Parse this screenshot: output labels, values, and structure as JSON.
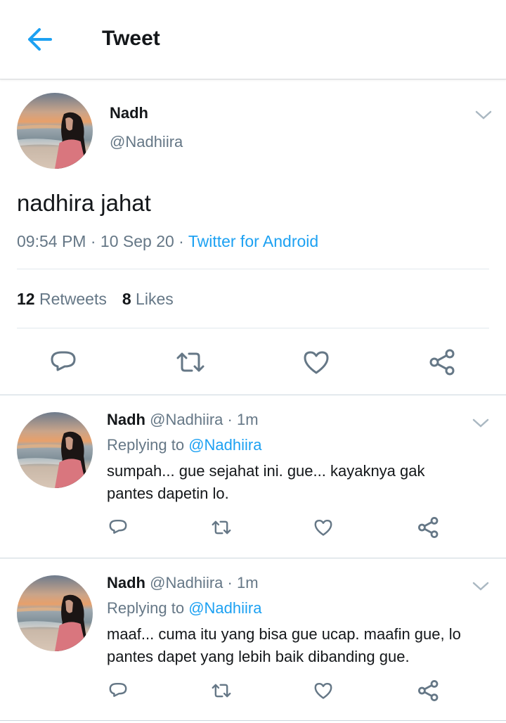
{
  "header": {
    "title": "Tweet",
    "back_icon": "arrow-left-icon"
  },
  "colors": {
    "accent": "#1da1f2",
    "secondary_text": "#657786",
    "primary_text": "#14171a"
  },
  "main_tweet": {
    "name": "Nadh",
    "handle": "@Nadhiira",
    "text": "nadhira jahat",
    "time": "09:54 PM",
    "date": "10 Sep 20",
    "source": "Twitter for Android",
    "separator": " · ",
    "retweets_count": "12",
    "retweets_label": "Retweets",
    "likes_count": "8",
    "likes_label": "Likes"
  },
  "replies": [
    {
      "name": "Nadh",
      "handle": "@Nadhiira",
      "time": "1m",
      "replying_prefix": "Replying to",
      "replying_to": "@Nadhiira",
      "text": "sumpah... gue sejahat ini. gue... kayaknya gak pantes dapetin lo."
    },
    {
      "name": "Nadh",
      "handle": "@Nadhiira",
      "time": "1m",
      "replying_prefix": "Replying to",
      "replying_to": "@Nadhiira",
      "text": "maaf... cuma itu yang bisa gue ucap. maafin gue, lo pantes dapet yang lebih baik dibanding gue."
    }
  ],
  "action_icons": [
    "reply-icon",
    "retweet-icon",
    "like-icon",
    "share-icon"
  ]
}
